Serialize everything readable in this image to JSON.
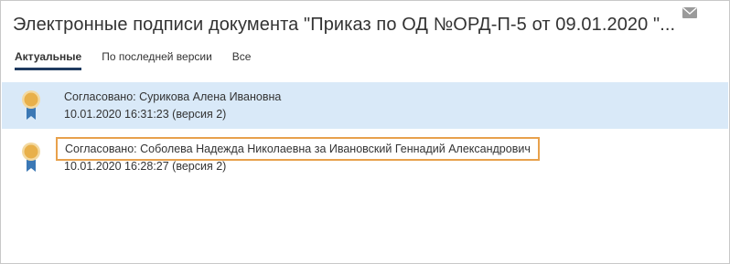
{
  "dialog": {
    "title": "Электронные подписи документа \"Приказ по ОД №ОРД-П-5 от 09.01.2020 \"..."
  },
  "tabs": [
    {
      "label": "Актуальные",
      "active": true
    },
    {
      "label": "По последней версии",
      "active": false
    },
    {
      "label": "Все",
      "active": false
    }
  ],
  "signatures": [
    {
      "status_line": "Согласовано: Сурикова Алена Ивановна",
      "datetime_line": "10.01.2020 16:31:23 (версия 2)",
      "selected": true
    },
    {
      "status_line": "Согласовано: Соболева Надежда Николаевна за Ивановский Геннадий Александрович",
      "datetime_line": "10.01.2020 16:28:27 (версия 2)",
      "selected": false,
      "highlighted": true
    }
  ],
  "icons": {
    "mail": "envelope-icon",
    "signature": "medal-icon"
  },
  "colors": {
    "selected_row": "#d9e9f8",
    "highlight_border": "#e8a14c",
    "active_tab_underline": "#1f3a60",
    "medal_gold": "#e8b04a",
    "ribbon_blue": "#3b78b5"
  }
}
